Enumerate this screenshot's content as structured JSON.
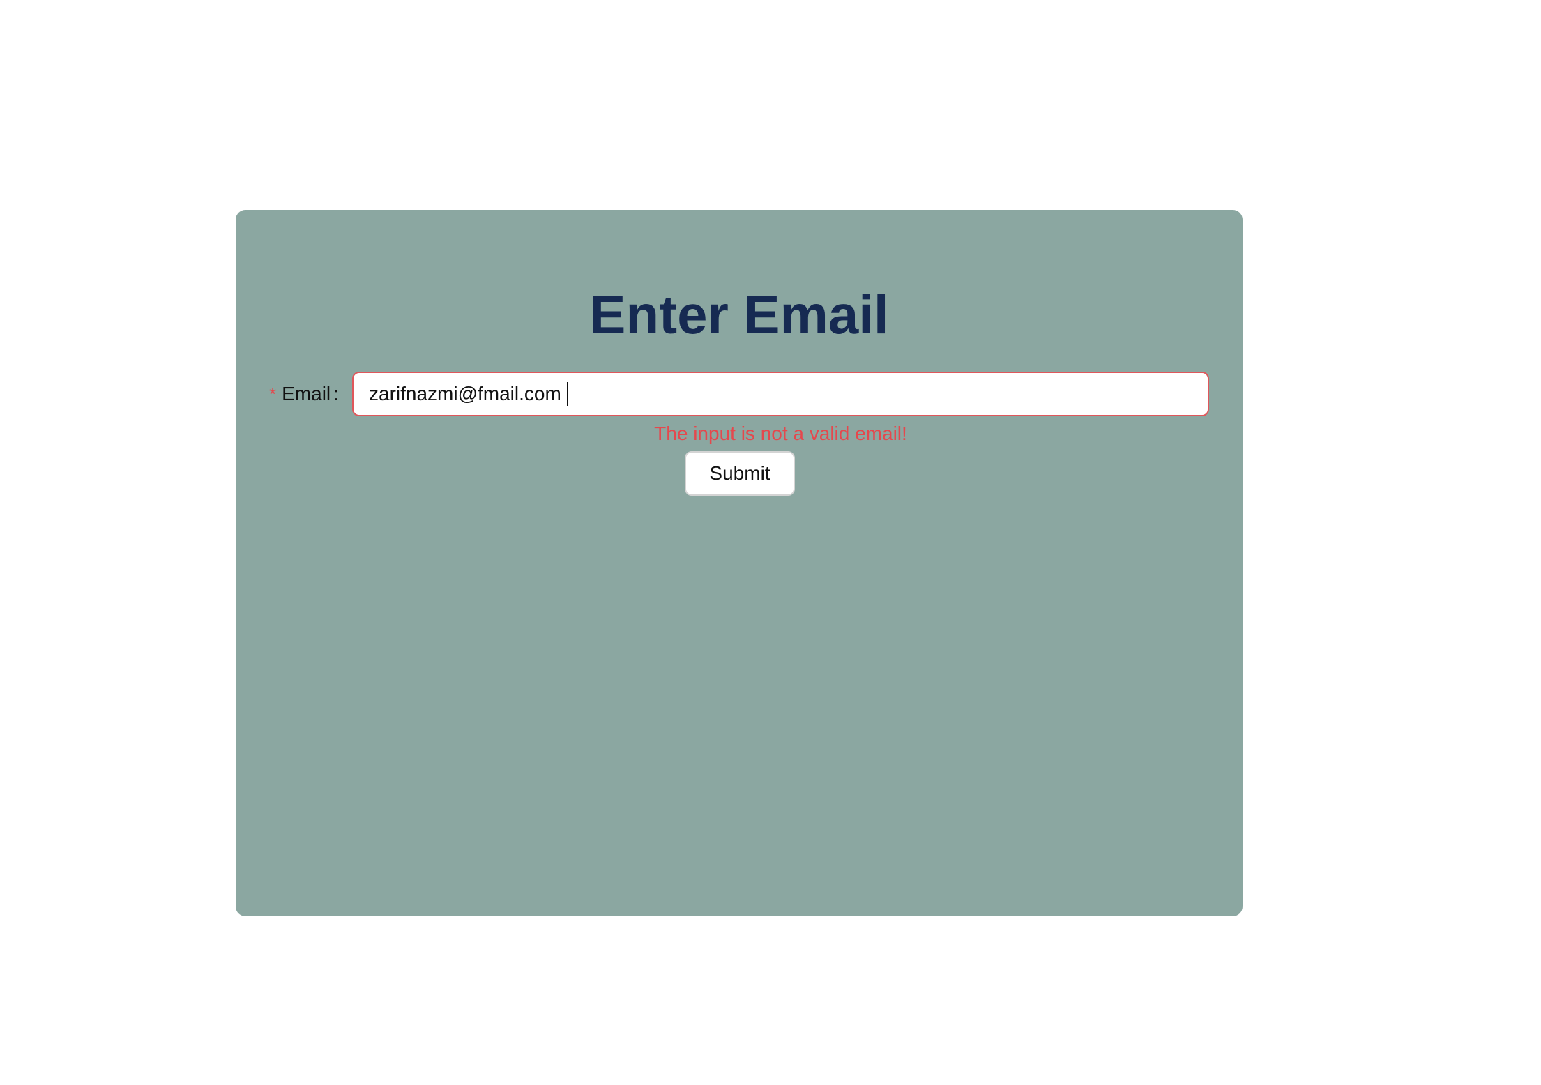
{
  "form": {
    "title": "Enter Email",
    "email_field": {
      "required_mark": "*",
      "label": "Email",
      "colon": ":",
      "value": "zarifnazmi@fmail.com",
      "error": "The input is not a valid email!"
    },
    "submit_label": "Submit"
  },
  "colors": {
    "card_background": "#8ba7a1",
    "title": "#162a52",
    "error": "#e5484d"
  }
}
